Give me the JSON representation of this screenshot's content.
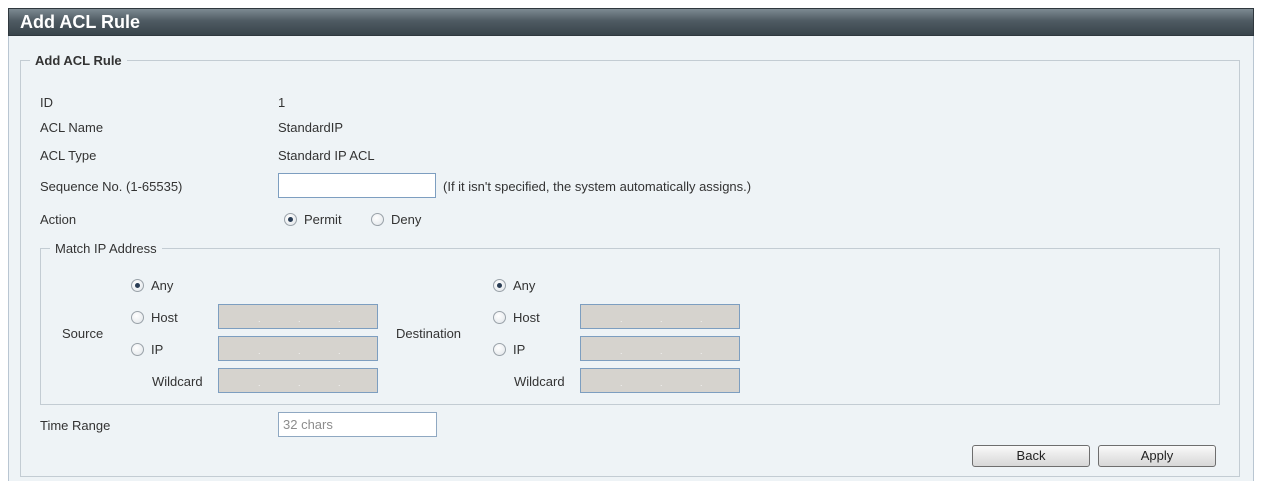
{
  "page": {
    "title": "Add ACL Rule",
    "section_legend": "Add ACL Rule"
  },
  "fields": {
    "id": {
      "label": "ID",
      "value": "1"
    },
    "acl_name": {
      "label": "ACL Name",
      "value": "StandardIP"
    },
    "acl_type": {
      "label": "ACL Type",
      "value": "Standard IP ACL"
    },
    "sequence": {
      "label": "Sequence No. (1-65535)",
      "value": "",
      "hint": "(If it isn't specified, the system automatically assigns.)"
    },
    "action": {
      "label": "Action",
      "options": [
        "Permit",
        "Deny"
      ],
      "selected": "Permit"
    },
    "time_range": {
      "label": "Time Range",
      "placeholder": "32 chars",
      "value": ""
    }
  },
  "match_ip": {
    "legend": "Match IP Address",
    "source": {
      "label": "Source",
      "any": "Any",
      "host": "Host",
      "ip": "IP",
      "wildcard": "Wildcard",
      "selected": "Any"
    },
    "destination": {
      "label": "Destination",
      "any": "Any",
      "host": "Host",
      "ip": "IP",
      "wildcard": "Wildcard",
      "selected": "Any"
    }
  },
  "buttons": {
    "back": "Back",
    "apply": "Apply"
  },
  "colors": {
    "title_bar": "#4f5b63",
    "panel_bg": "#eef3f6",
    "disabled_input": "#d6d3ce",
    "input_border": "#7d9ec0"
  }
}
